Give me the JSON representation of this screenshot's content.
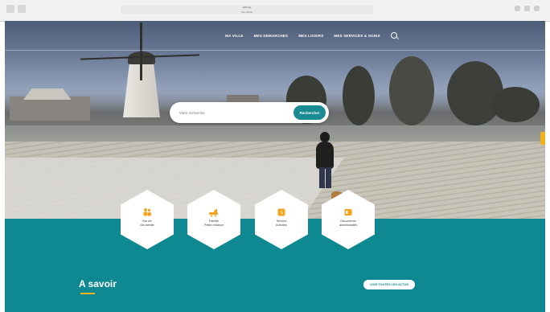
{
  "browser": {
    "url": "tellin.be",
    "subtitle": "Site officiel"
  },
  "nav": {
    "items": [
      "MA VILLE",
      "MES DEMARCHES",
      "MES LOISIRS",
      "MES SERVICES & SOINS"
    ]
  },
  "search": {
    "placeholder": "Votre recherche",
    "button_label": "Rechercher"
  },
  "quick_links": [
    {
      "icon": "family-icon",
      "line1": "Ma vie",
      "line2": "Ma famille"
    },
    {
      "icon": "baby-icon",
      "line1": "Famille",
      "line2": "Petite enfance"
    },
    {
      "icon": "age-icon",
      "line1": "Seniors",
      "line2": "Activités"
    },
    {
      "icon": "id-card-icon",
      "line1": "Documents",
      "line2": "administratifs"
    }
  ],
  "section": {
    "title": "A savoir",
    "button_label": "VOIR TOUTES LES ACTUS"
  },
  "colors": {
    "teal": "#0e8891",
    "accent": "#f2b21b",
    "white": "#ffffff"
  }
}
